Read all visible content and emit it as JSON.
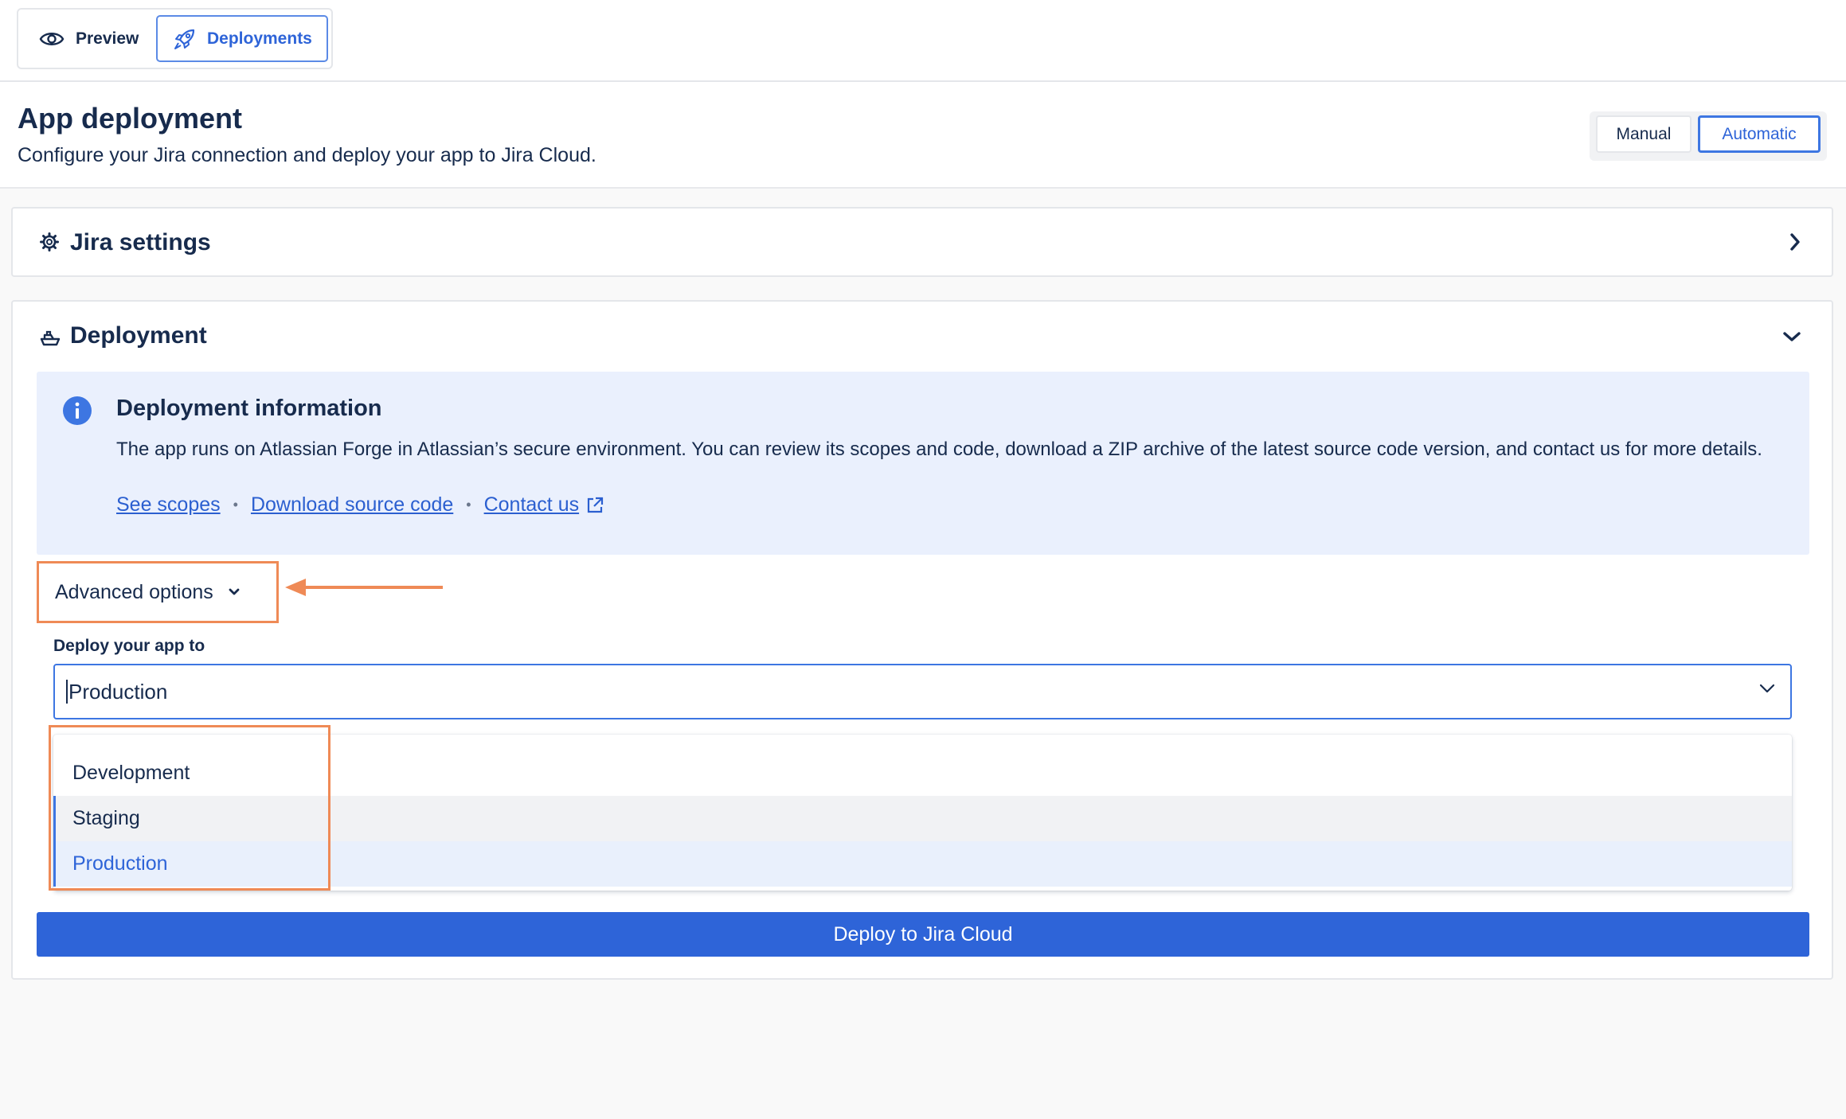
{
  "tabs": [
    {
      "label": "Preview",
      "icon": "eye-icon"
    },
    {
      "label": "Deployments",
      "icon": "rocket-icon"
    }
  ],
  "header": {
    "title": "App deployment",
    "subtitle": "Configure your Jira connection and deploy your app to Jira Cloud.",
    "modes": {
      "manual": "Manual",
      "automatic": "Automatic",
      "selected": "Automatic"
    }
  },
  "jira_settings": {
    "title": "Jira settings",
    "icon": "gear-icon",
    "state": "collapsed"
  },
  "deployment": {
    "title": "Deployment",
    "icon": "ship-icon",
    "state": "expanded",
    "info": {
      "title": "Deployment information",
      "text": "The app runs on Atlassian Forge in Atlassian’s secure environment. You can review its scopes and code, download a ZIP archive of the latest source code version, and contact us for more details.",
      "links": {
        "scopes": "See scopes",
        "download": "Download source code",
        "contact": "Contact us"
      }
    },
    "advanced_label": "Advanced options",
    "field_label": "Deploy your app to",
    "selected_value": "Production",
    "options": [
      "Development",
      "Staging",
      "Production"
    ],
    "deploy_button": "Deploy to Jira Cloud"
  },
  "colors": {
    "accent": "#2e64d8",
    "annotation": "#ef8a56",
    "info_bg": "#eaf0fd"
  }
}
